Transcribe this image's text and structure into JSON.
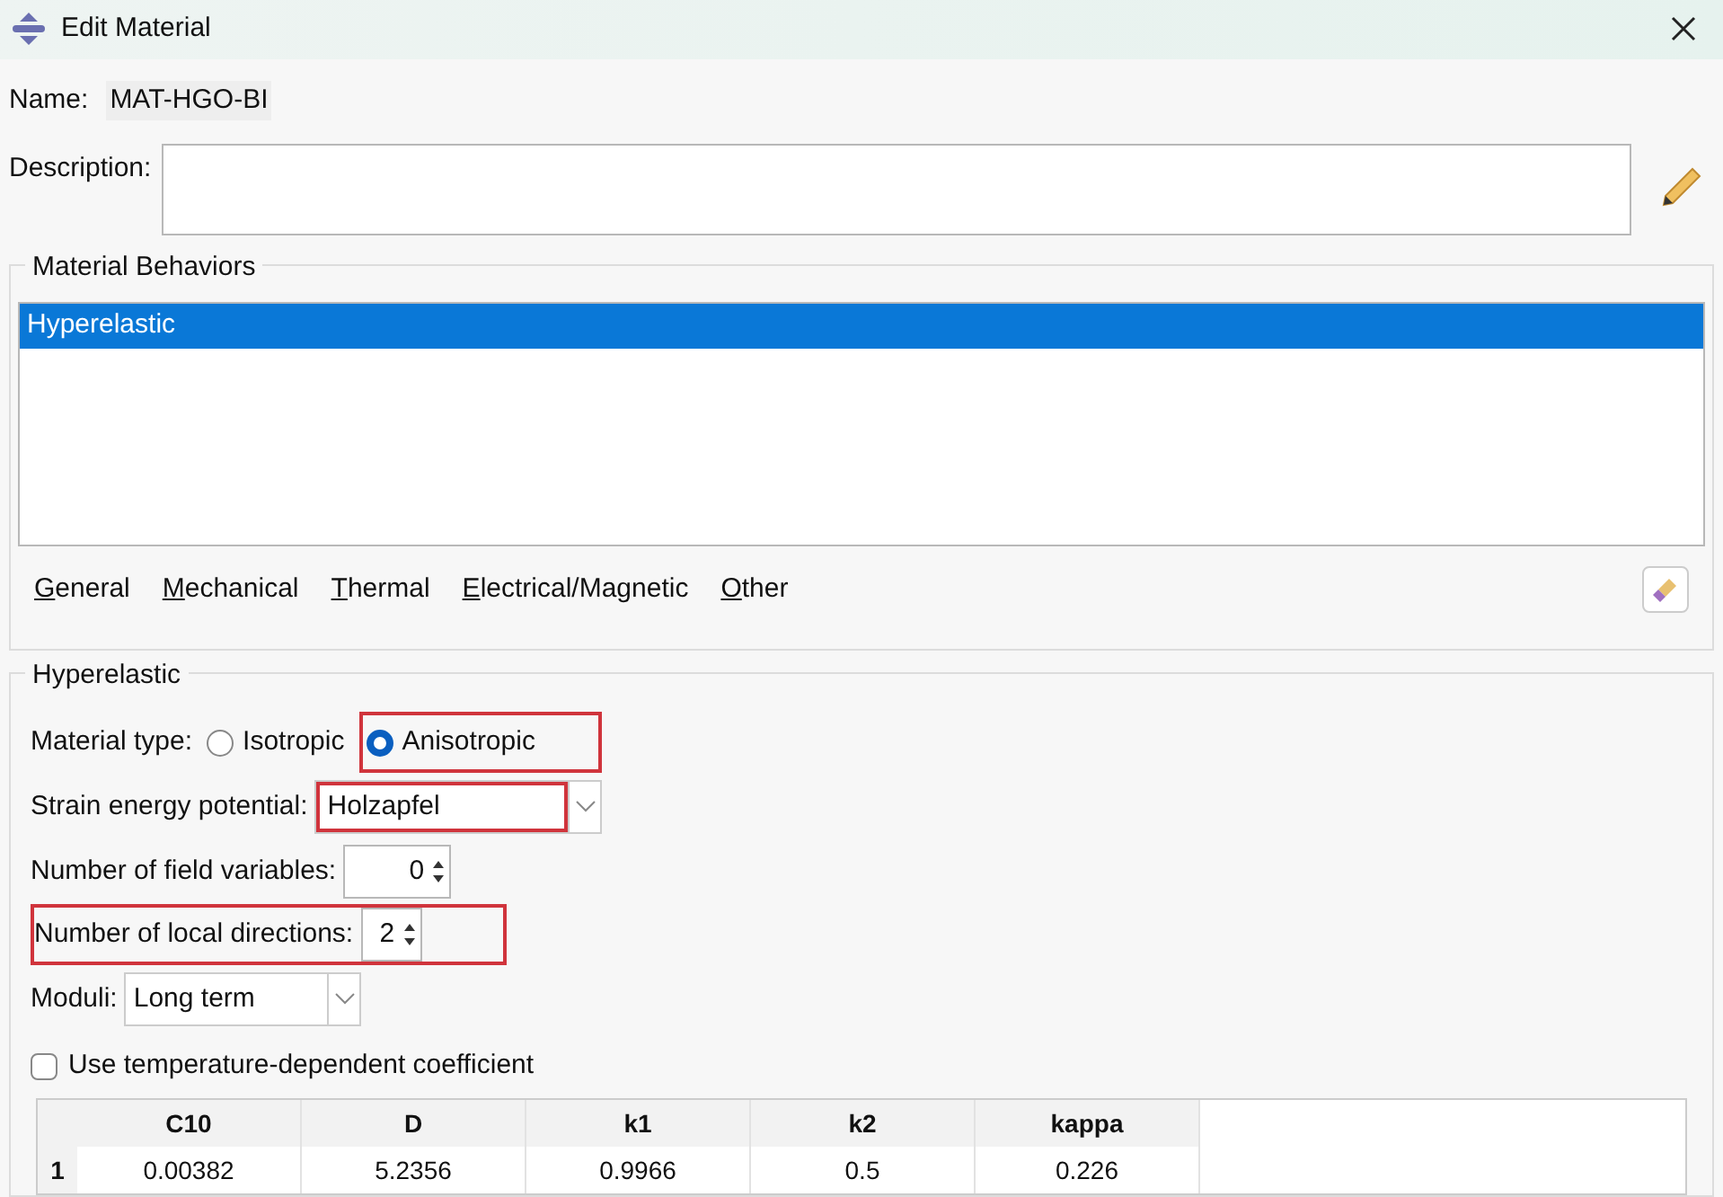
{
  "window": {
    "title": "Edit Material"
  },
  "name": {
    "label": "Name:",
    "value": "MAT-HGO-BI"
  },
  "description": {
    "label": "Description:"
  },
  "behaviors": {
    "title": "Material Behaviors",
    "items": [
      {
        "label": "Hyperelastic",
        "selected": true
      }
    ]
  },
  "menus": [
    {
      "label": "General"
    },
    {
      "label": "Mechanical"
    },
    {
      "label": "Thermal"
    },
    {
      "label": "Electrical/Magnetic"
    },
    {
      "label": "Other"
    }
  ],
  "section": {
    "title": "Hyperelastic"
  },
  "material_type": {
    "label": "Material type:",
    "highlighted": true,
    "options": [
      {
        "label": "Isotropic",
        "selected": false
      },
      {
        "label": "Anisotropic",
        "selected": true
      }
    ]
  },
  "strain_energy": {
    "label": "Strain energy potential:",
    "value": "Holzapfel",
    "highlighted": true
  },
  "field_variables": {
    "label": "Number of field variables:",
    "value": "0"
  },
  "local_directions": {
    "label": "Number of local directions:",
    "value": "2",
    "highlighted": true
  },
  "moduli": {
    "label": "Moduli:",
    "value": "Long term"
  },
  "temperature_dependent": {
    "label": "Use temperature-dependent coefficient",
    "checked": false
  },
  "table": {
    "columns": [
      "C10",
      "D",
      "k1",
      "k2",
      "kappa"
    ],
    "rows": [
      {
        "index": "1",
        "cells": [
          "0.00382",
          "5.2356",
          "0.9966",
          "0.5",
          "0.226"
        ]
      }
    ]
  }
}
